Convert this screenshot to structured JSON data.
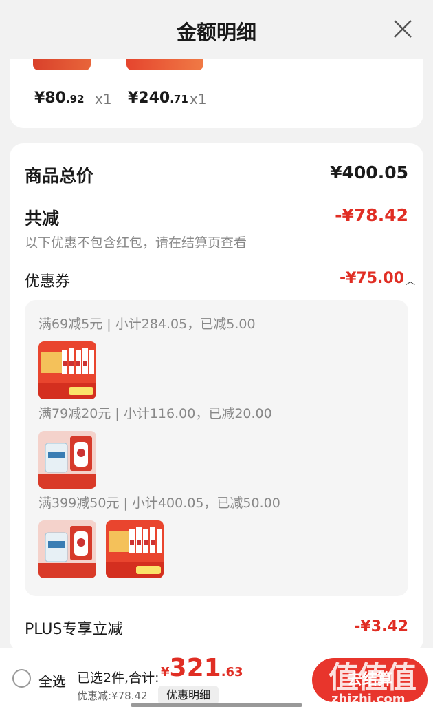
{
  "header": {
    "title": "金额明细"
  },
  "items": [
    {
      "price_int": "¥80",
      "price_dec": ".92",
      "qty": "x1"
    },
    {
      "price_int": "¥240",
      "price_dec": ".71",
      "qty": "x1"
    }
  ],
  "summary": {
    "total_label": "商品总价",
    "total_value": "¥400.05",
    "reduce_label": "共减",
    "reduce_value": "-¥78.42",
    "hint": "以下优惠不包含红包，请在结算页查看",
    "coupon_label": "优惠券",
    "coupon_value": "-¥75.00",
    "coupon_rules": [
      "满69减5元 | 小计284.05，已减5.00",
      "满79减20元 | 小计116.00，已减20.00",
      "满399减50元 | 小计400.05，已减50.00"
    ],
    "plus_label": "PLUS专享立减",
    "plus_value": "-¥3.42"
  },
  "footer": {
    "select_all": "全选",
    "selected_info": "已选2件,合计:",
    "total_cur": "¥",
    "total_int": "321",
    "total_dec": ".63",
    "discount": "优惠减:¥78.42",
    "detail_button": "优惠明细",
    "checkout_button": "去结算",
    "watermark": "zhizhi.com",
    "watermark_big": "值值值"
  },
  "colors": {
    "accent": "#e02e24",
    "checkout": "#e8352c"
  }
}
